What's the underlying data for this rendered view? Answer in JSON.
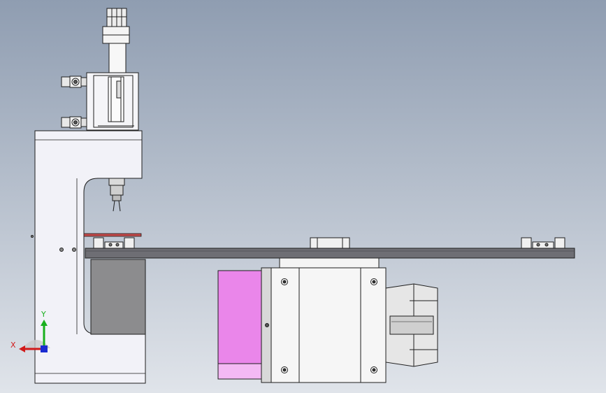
{
  "viewport": {
    "background_top": "#8f9db1",
    "background_bottom": "#e0e4ea"
  },
  "triad": {
    "x_label": "X",
    "y_label": "Y",
    "x_color": "#d11a1a",
    "y_color": "#19b01e",
    "z_color": "#1a2bd1"
  },
  "colors": {
    "frame": "#f2f2f8",
    "edge": "#1e1e1e",
    "rail": "#6e6e74",
    "stand": "#8c8c8e",
    "motor_side_panel": "#ea86ea",
    "gear_shaft": "#cfcfcf",
    "pcb_strip": "#c44a4a"
  },
  "icons": {
    "triad": "coordinate-triad-icon",
    "fitting": "pneumatic-fitting-icon"
  }
}
